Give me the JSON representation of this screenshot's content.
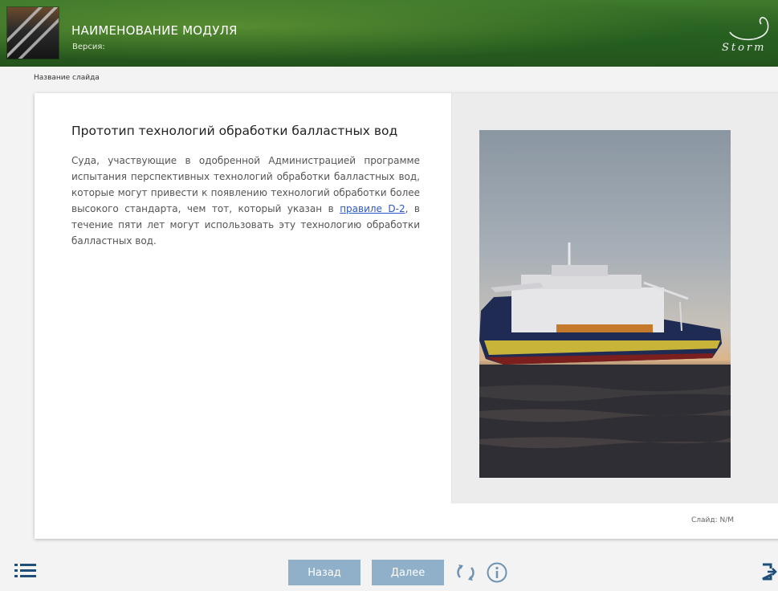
{
  "header": {
    "module_title": "НАИМЕНОВАНИЕ МОДУЛЯ",
    "version_label": "Версия:",
    "logo_text": "Storm"
  },
  "breadcrumb": {
    "slide_name": "Название слайда"
  },
  "slide": {
    "heading": "Прототип технологий обработки балластных вод",
    "paragraph_before_link": "Суда, участвующие в одобренной Администрацией программе испытания перспективных технологий обработки балластных вод, которые могут привести к появлению технологий обработки более высокого стандарта, чем тот, который указан в ",
    "link_text": "правиле D-2",
    "paragraph_after_link": ", в течение пяти лет могут использовать эту технологию обработки балластных вод.",
    "counter": "Слайд: N/M"
  },
  "navigation": {
    "back_label": "Назад",
    "next_label": "Далее"
  },
  "icons": {
    "menu": "list-menu-icon",
    "reload": "reload-icon",
    "info": "info-icon",
    "exit": "exit-icon"
  },
  "colors": {
    "header_green": "#2d6322",
    "nav_button": "#8fb0c8",
    "link": "#2b59c3"
  }
}
